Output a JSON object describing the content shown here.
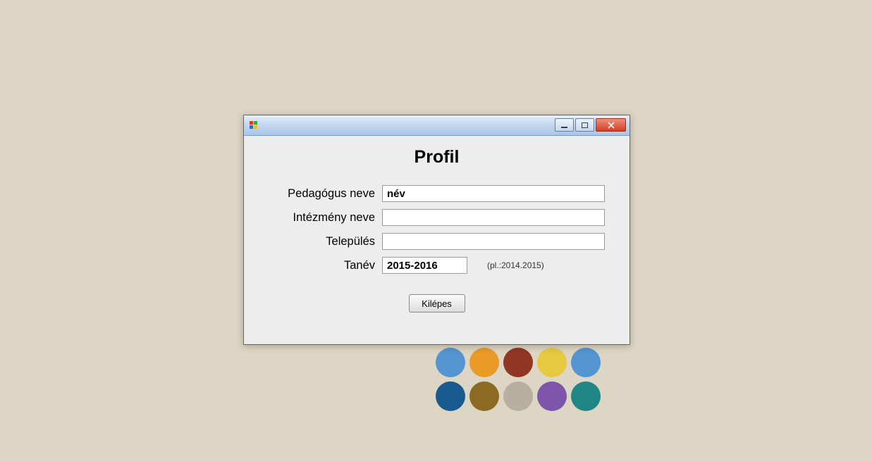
{
  "palette": {
    "row1": [
      "#5395d0",
      "#ea9a27",
      "#913525",
      "#e6c940",
      "#5395d0"
    ],
    "row2": [
      "#1a5b8f",
      "#8b6b22",
      "#b9afa0",
      "#7e55aa",
      "#1f8585"
    ]
  },
  "window": {
    "title": "Profil",
    "fields": {
      "pedagogus_label": "Pedagógus neve",
      "pedagogus_value": "név",
      "intezmeny_label": "Intézmény neve",
      "intezmeny_value": "",
      "telepules_label": "Település",
      "telepules_value": "",
      "tanev_label": "Tanév",
      "tanev_value": "2015-2016",
      "tanev_hint": "(pl.:2014.2015)"
    },
    "exit_label": "Kilépes"
  }
}
